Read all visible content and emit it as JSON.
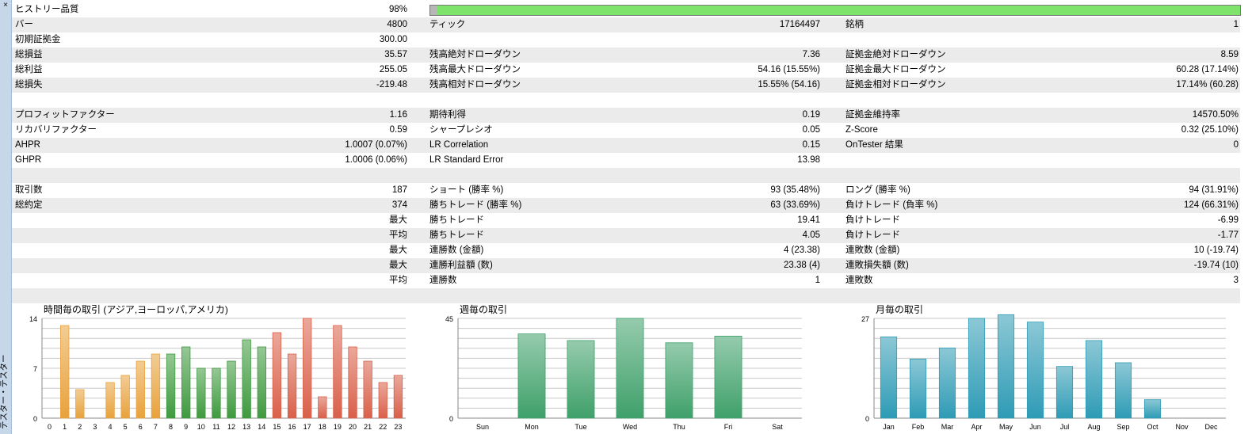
{
  "window": {
    "close_label": "×",
    "side_tab": "テスター・テスター"
  },
  "history_quality": {
    "label": "ヒストリー品質",
    "value": "98%",
    "fraction": 0.98,
    "fill_color": "#7ee36a"
  },
  "rows": [
    {
      "shade": false,
      "c1": [
        "ヒストリー品質",
        "98%"
      ],
      "c2": [
        "",
        ""
      ],
      "c3": [
        "",
        ""
      ],
      "bar": true
    },
    {
      "shade": true,
      "c1": [
        "バー",
        "4800"
      ],
      "c2": [
        "ティック",
        "17164497"
      ],
      "c3": [
        "銘柄",
        "1"
      ]
    },
    {
      "shade": false,
      "c1": [
        "初期証拠金",
        "300.00"
      ],
      "c2": [
        "",
        ""
      ],
      "c3": [
        "",
        ""
      ]
    },
    {
      "shade": true,
      "c1": [
        "総損益",
        "35.57"
      ],
      "c2": [
        "残高絶対ドローダウン",
        "7.36"
      ],
      "c3": [
        "証拠金絶対ドローダウン",
        "8.59"
      ]
    },
    {
      "shade": false,
      "c1": [
        "総利益",
        "255.05"
      ],
      "c2": [
        "残高最大ドローダウン",
        "54.16 (15.55%)"
      ],
      "c3": [
        "証拠金最大ドローダウン",
        "60.28 (17.14%)"
      ]
    },
    {
      "shade": true,
      "c1": [
        "総損失",
        "-219.48"
      ],
      "c2": [
        "残高相対ドローダウン",
        "15.55% (54.16)"
      ],
      "c3": [
        "証拠金相対ドローダウン",
        "17.14% (60.28)"
      ]
    },
    {
      "shade": false,
      "c1": [
        "",
        ""
      ],
      "c2": [
        "",
        ""
      ],
      "c3": [
        "",
        ""
      ]
    },
    {
      "shade": true,
      "c1": [
        "プロフィットファクター",
        "1.16"
      ],
      "c2": [
        "期待利得",
        "0.19"
      ],
      "c3": [
        "証拠金維持率",
        "14570.50%"
      ]
    },
    {
      "shade": false,
      "c1": [
        "リカバリファクター",
        "0.59"
      ],
      "c2": [
        "シャープレシオ",
        "0.05"
      ],
      "c3": [
        "Z-Score",
        "0.32 (25.10%)"
      ]
    },
    {
      "shade": true,
      "c1": [
        "AHPR",
        "1.0007 (0.07%)"
      ],
      "c2": [
        "LR Correlation",
        "0.15"
      ],
      "c3": [
        "OnTester 結果",
        "0"
      ]
    },
    {
      "shade": false,
      "c1": [
        "GHPR",
        "1.0006 (0.06%)"
      ],
      "c2": [
        "LR Standard Error",
        "13.98"
      ],
      "c3": [
        "",
        ""
      ]
    },
    {
      "shade": true,
      "c1": [
        "",
        ""
      ],
      "c2": [
        "",
        ""
      ],
      "c3": [
        "",
        ""
      ]
    },
    {
      "shade": false,
      "c1": [
        "取引数",
        "187"
      ],
      "c2": [
        "ショート (勝率 %)",
        "93 (35.48%)"
      ],
      "c3": [
        "ロング (勝率 %)",
        "94 (31.91%)"
      ]
    },
    {
      "shade": true,
      "c1": [
        "総約定",
        "374"
      ],
      "c2": [
        "勝ちトレード (勝率 %)",
        "63 (33.69%)"
      ],
      "c3": [
        "負けトレード (負率 %)",
        "124 (66.31%)"
      ]
    },
    {
      "shade": false,
      "c1": [
        "",
        "最大"
      ],
      "c2": [
        "勝ちトレード",
        "19.41"
      ],
      "c3": [
        "負けトレード",
        "-6.99"
      ]
    },
    {
      "shade": true,
      "c1": [
        "",
        "平均"
      ],
      "c2": [
        "勝ちトレード",
        "4.05"
      ],
      "c3": [
        "負けトレード",
        "-1.77"
      ]
    },
    {
      "shade": false,
      "c1": [
        "",
        "最大"
      ],
      "c2": [
        "連勝数 (金額)",
        "4 (23.38)"
      ],
      "c3": [
        "連敗数 (金額)",
        "10 (-19.74)"
      ]
    },
    {
      "shade": true,
      "c1": [
        "",
        "最大"
      ],
      "c2": [
        "連勝利益額 (数)",
        "23.38 (4)"
      ],
      "c3": [
        "連敗損失額 (数)",
        "-19.74 (10)"
      ]
    },
    {
      "shade": false,
      "c1": [
        "",
        "平均"
      ],
      "c2": [
        "連勝数",
        "1"
      ],
      "c3": [
        "連敗数",
        "3"
      ]
    },
    {
      "shade": true,
      "c1": [
        "",
        ""
      ],
      "c2": [
        "",
        ""
      ],
      "c3": [
        "",
        ""
      ]
    }
  ],
  "chart_data": [
    {
      "type": "bar",
      "title": "時間毎の取引 (アジア,ヨーロッパ,アメリカ)",
      "categories": [
        "0",
        "1",
        "2",
        "3",
        "4",
        "5",
        "6",
        "7",
        "8",
        "9",
        "10",
        "11",
        "12",
        "13",
        "14",
        "15",
        "16",
        "17",
        "18",
        "19",
        "20",
        "21",
        "22",
        "23"
      ],
      "values": [
        0,
        13,
        4,
        0,
        5,
        6,
        8,
        9,
        9,
        10,
        7,
        7,
        8,
        11,
        10,
        12,
        9,
        14,
        3,
        13,
        10,
        8,
        5,
        6
      ],
      "ylim": [
        0,
        14
      ],
      "yticks": [
        0,
        7,
        14
      ],
      "colors": [
        "#e8a23c",
        "#e8a23c",
        "#e8a23c",
        "#e8a23c",
        "#e8a23c",
        "#e8a23c",
        "#e8a23c",
        "#e8a23c",
        "#3f9a3f",
        "#3f9a3f",
        "#3f9a3f",
        "#3f9a3f",
        "#3f9a3f",
        "#3f9a3f",
        "#3f9a3f",
        "#d9604a",
        "#d9604a",
        "#d9604a",
        "#d9604a",
        "#d9604a",
        "#d9604a",
        "#d9604a",
        "#d9604a",
        "#d9604a"
      ],
      "grid": true
    },
    {
      "type": "bar",
      "title": "週毎の取引",
      "categories": [
        "Sun",
        "Mon",
        "Tue",
        "Wed",
        "Thu",
        "Fri",
        "Sat"
      ],
      "values": [
        0,
        38,
        35,
        45,
        34,
        37,
        0
      ],
      "ylim": [
        0,
        45
      ],
      "yticks": [
        0,
        45
      ],
      "colors": [
        "#3fa06a",
        "#3fa06a",
        "#3fa06a",
        "#3fa06a",
        "#3fa06a",
        "#3fa06a",
        "#3fa06a"
      ],
      "grid": true
    },
    {
      "type": "bar",
      "title": "月毎の取引",
      "categories": [
        "Jan",
        "Feb",
        "Mar",
        "Apr",
        "May",
        "Jun",
        "Jul",
        "Aug",
        "Sep",
        "Oct",
        "Nov",
        "Dec"
      ],
      "values": [
        22,
        16,
        19,
        27,
        28,
        26,
        14,
        21,
        15,
        5,
        0,
        0
      ],
      "ylim": [
        0,
        27
      ],
      "yticks": [
        0,
        27
      ],
      "colors": [
        "#2e9bb5",
        "#2e9bb5",
        "#2e9bb5",
        "#2e9bb5",
        "#2e9bb5",
        "#2e9bb5",
        "#2e9bb5",
        "#2e9bb5",
        "#2e9bb5",
        "#2e9bb5",
        "#2e9bb5",
        "#2e9bb5"
      ],
      "grid": true
    }
  ]
}
